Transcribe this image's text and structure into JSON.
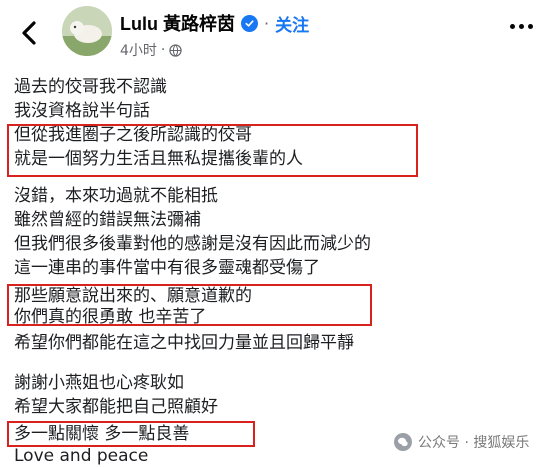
{
  "header": {
    "author_name": "Lulu 黃路梓茵",
    "follow_label": "关注",
    "separator": "·",
    "time_label": "4小时"
  },
  "post": {
    "lines": [
      "過去的佼哥我不認識",
      "我沒資格說半句話",
      "但從我進圈子之後所認識的佼哥",
      "就是一個努力生活且無私提攜後輩的人",
      "沒錯，本來功過就不能相抵",
      "雖然曾經的錯誤無法彌補",
      "但我們很多後輩對他的感謝是沒有因此而減少的",
      "這一連串的事件當中有很多靈魂都受傷了",
      "那些願意說出來的、願意道歉的",
      "你們真的很勇敢 也辛苦了",
      "希望你們都能在這之中找回力量並且回歸平靜",
      "謝謝小燕姐也心疼耿如",
      "希望大家都能把自己照顧好",
      "多一點關懷 多一點良善",
      "Love and peace"
    ]
  },
  "watermark": {
    "text": "公众号 · 搜狐娱乐"
  },
  "colors": {
    "highlight": "#d9211e",
    "link": "#1877f2"
  }
}
